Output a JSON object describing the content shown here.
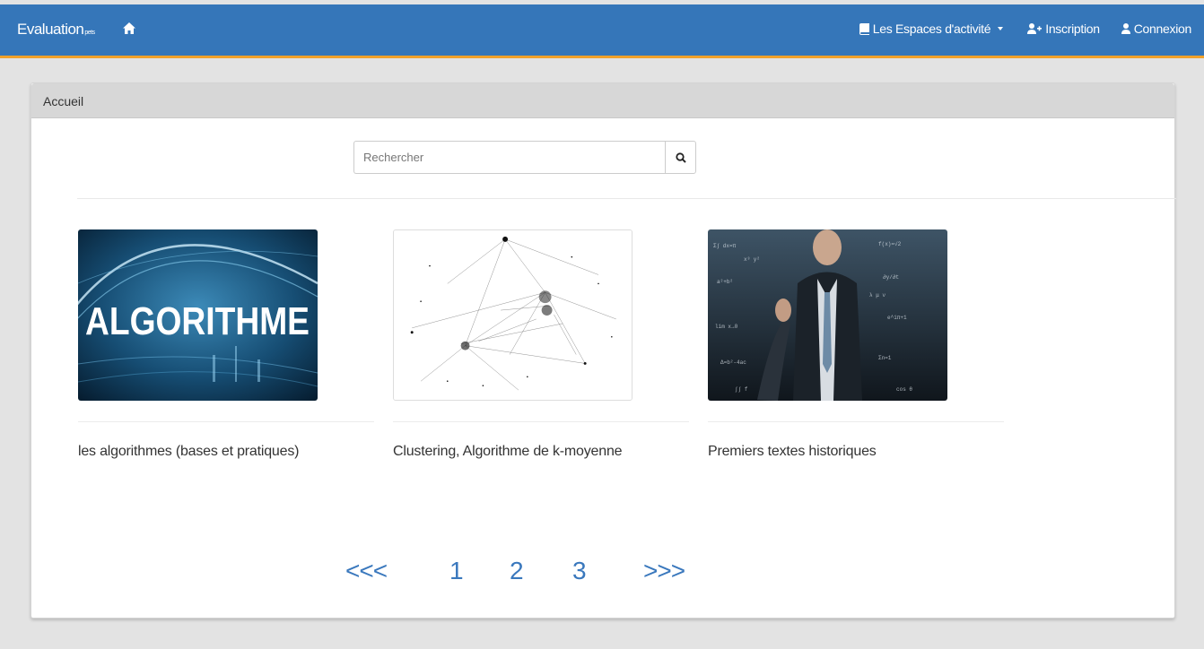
{
  "navbar": {
    "brand": "Evaluation",
    "brand_suffix": "pets",
    "home_icon": "home-icon",
    "espaces_label": "Les Espaces d'activité",
    "inscription_label": "Inscription",
    "connexion_label": "Connexion",
    "accent_color": "#3576b9",
    "border_color": "#f0a12b"
  },
  "panel": {
    "heading": "Accueil"
  },
  "search": {
    "placeholder": "Rechercher",
    "value": "",
    "icon": "search-icon"
  },
  "cards": [
    {
      "title": "les algorithmes (bases et pratiques)",
      "image_text": "ALGORITHME"
    },
    {
      "title": "Clustering, Algorithme de k-moyenne"
    },
    {
      "title": "Premiers textes historiques"
    }
  ],
  "pagination": {
    "prev": "<<<",
    "pages": [
      "1",
      "2",
      "3"
    ],
    "next": ">>>",
    "color": "#3a78bd"
  }
}
